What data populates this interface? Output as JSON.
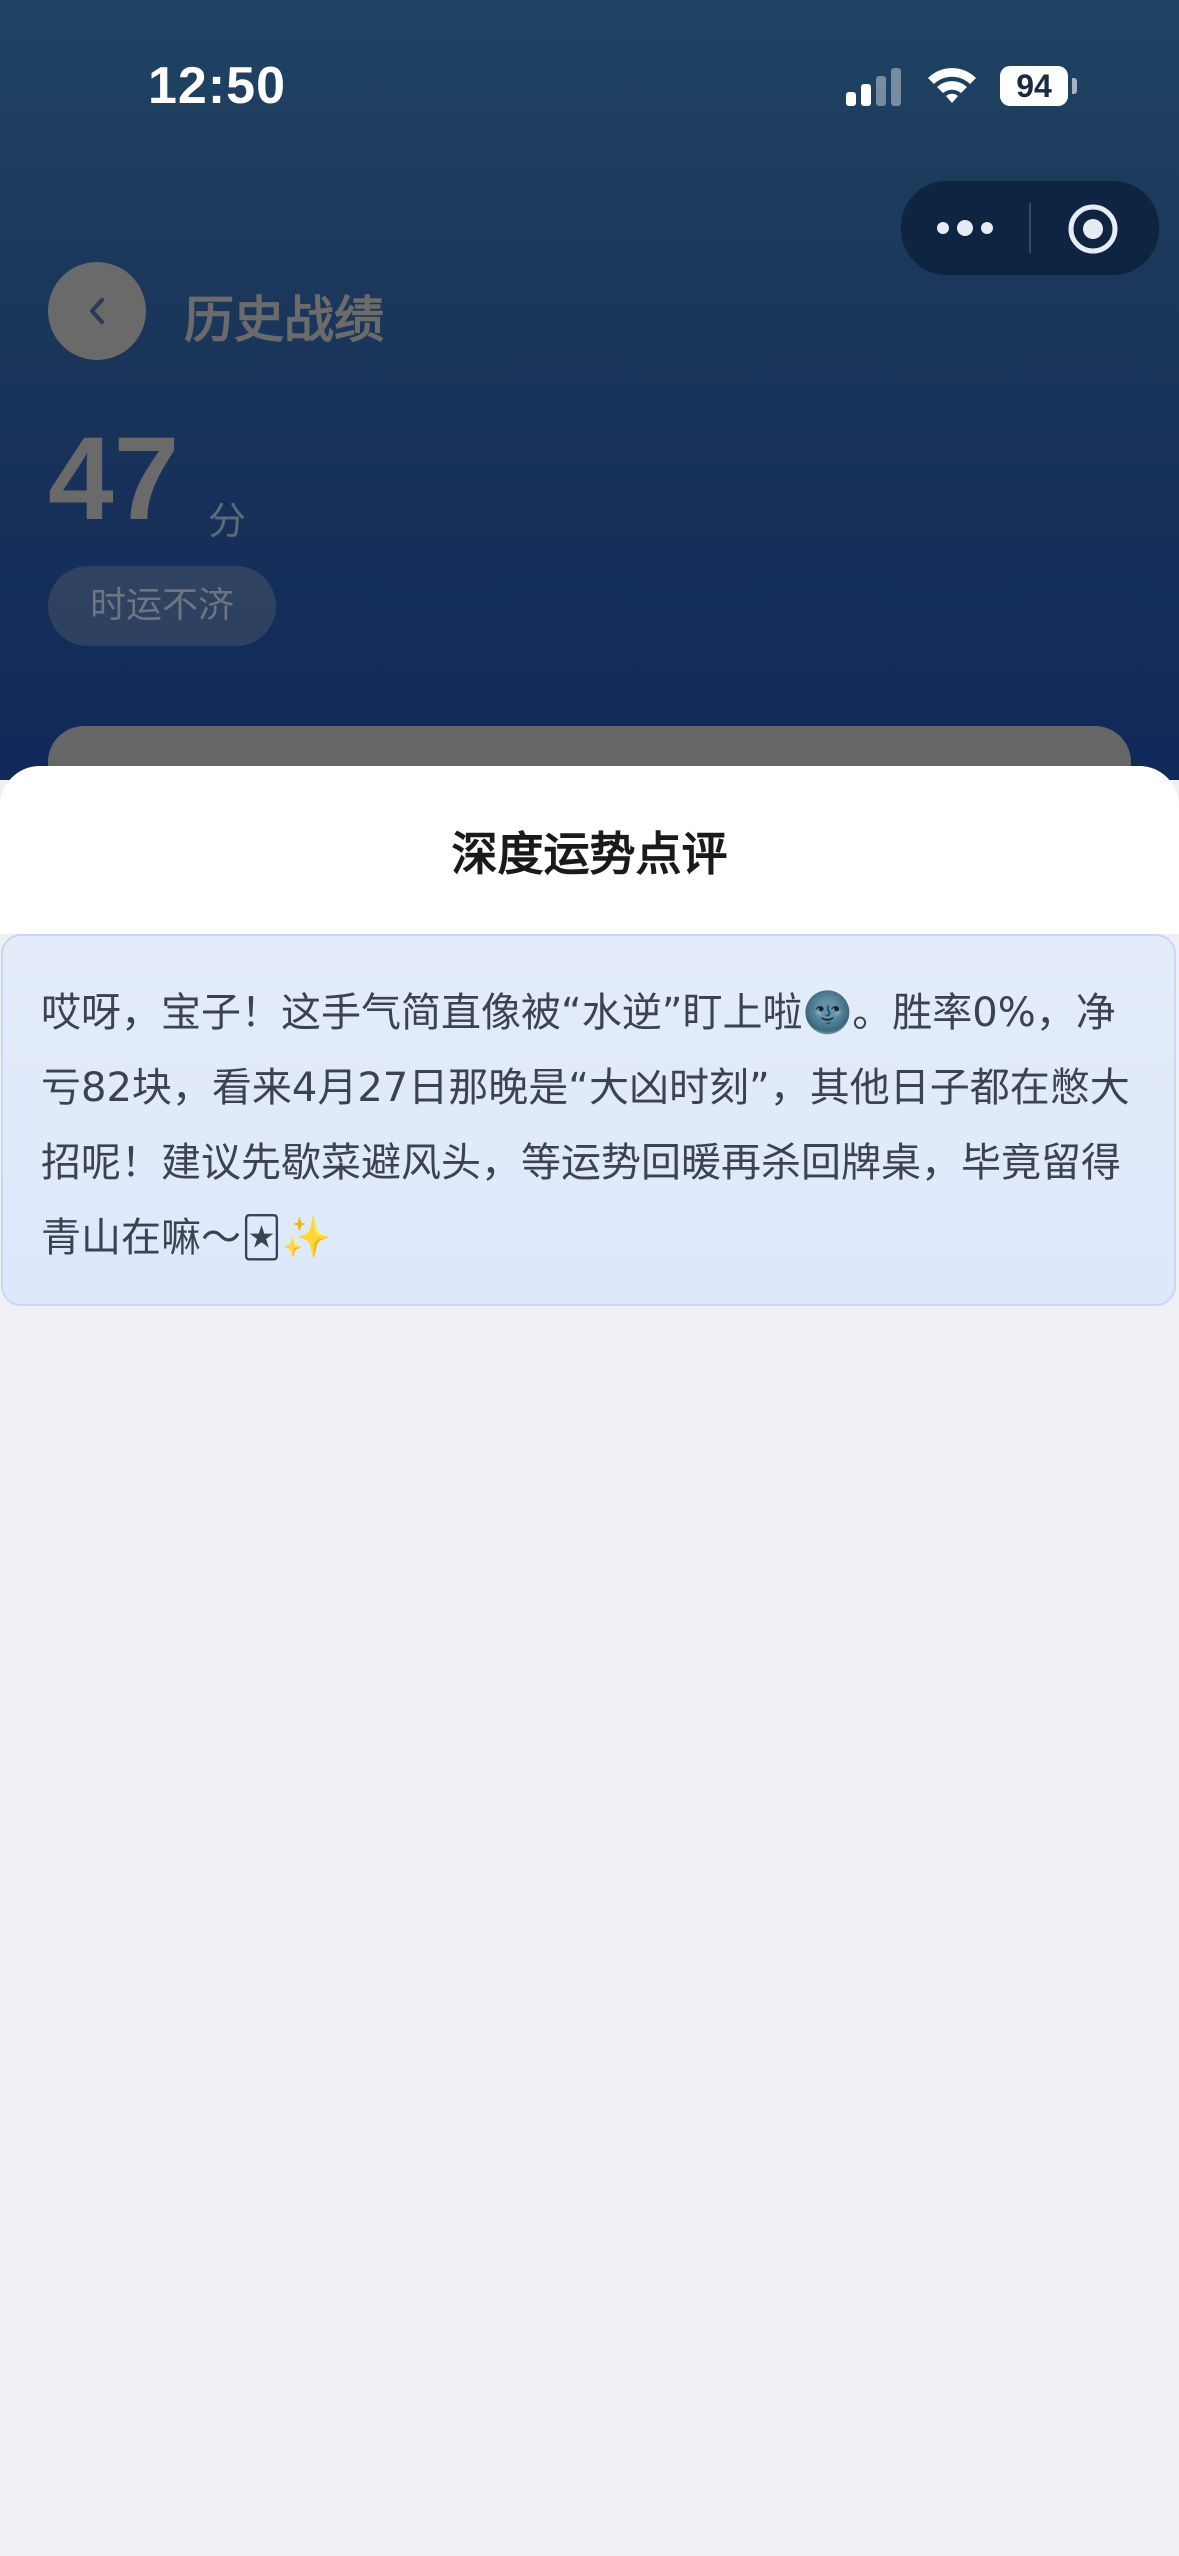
{
  "status_bar": {
    "time": "12:50",
    "battery": "94",
    "icons": [
      "signal-icon",
      "wifi-icon",
      "battery-icon"
    ]
  },
  "header": {
    "title": "历史战绩",
    "back_icon": "chevron-left-icon"
  },
  "miniprogram_capsule": {
    "icons": [
      "more-icon",
      "close-target-icon"
    ]
  },
  "summary": {
    "score": "47",
    "score_unit": "分",
    "fortune_label": "时运不济"
  },
  "sheet": {
    "title": "深度运势点评",
    "review": "哎呀，宝子！这手气简直像被“水逆”盯上啦🌚。胜率0%，净亏82块，看来4月27日那晚是“大凶时刻”，其他日子都在憋大招呢！建议先歇菜避风头，等运势回暖再杀回牌桌，毕竟留得青山在嘛～🃏✨"
  },
  "colors": {
    "header_gradient_top": "#1f4363",
    "header_gradient_bottom": "#10285a",
    "sheet_bg": "#eef0f4",
    "review_card_bg": "#e4ecfa",
    "review_card_border": "#c9d7f2"
  }
}
